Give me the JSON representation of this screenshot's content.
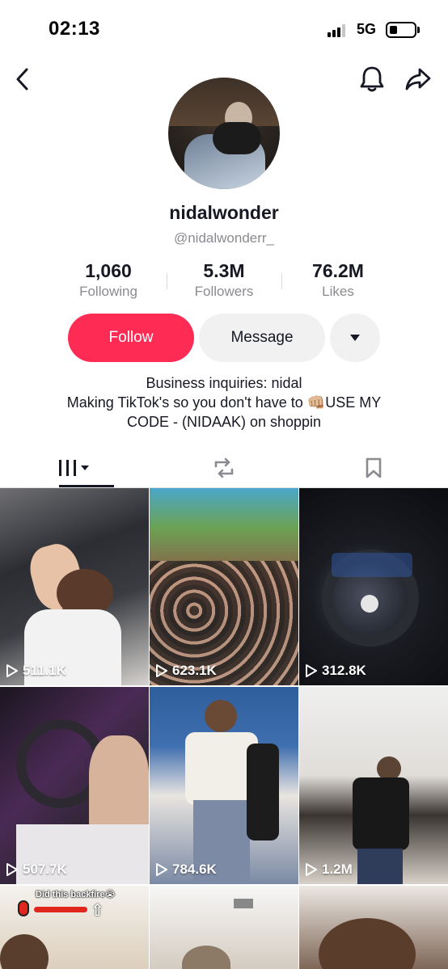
{
  "status_bar": {
    "time": "02:13",
    "network": "5G"
  },
  "profile": {
    "display_name": "nidalwonder",
    "handle": "@nidalwonderr_",
    "stats": [
      {
        "value": "1,060",
        "label": "Following"
      },
      {
        "value": "5.3M",
        "label": "Followers"
      },
      {
        "value": "76.2M",
        "label": "Likes"
      }
    ],
    "buttons": {
      "follow": "Follow",
      "message": "Message"
    },
    "bio_lines": [
      "Business inquiries: nidal",
      "Making TikTok's so you don't have to 👊🏼USE MY",
      "CODE - (NIDAAK) on shoppin"
    ]
  },
  "tabs": [
    "videos",
    "reposts",
    "favorites"
  ],
  "videos": [
    {
      "views": "511.1K"
    },
    {
      "views": "623.1K"
    },
    {
      "views": "312.8K"
    },
    {
      "views": "507.7K"
    },
    {
      "views": "784.6K"
    },
    {
      "views": "1.2M"
    }
  ],
  "partial_tile_caption": "Did this backfire😭",
  "icons": {
    "back": "chevron-left-icon",
    "bell": "bell-icon",
    "share": "share-arrow-icon",
    "dropdown": "caret-down-icon",
    "grid": "grid-icon",
    "repost": "repost-icon",
    "bookmark": "bookmark-icon",
    "play": "play-icon"
  },
  "colors": {
    "accent": "#fe2c55",
    "text": "#161823",
    "secondary": "#8a8b91",
    "button_bg": "#f1f1f2"
  }
}
